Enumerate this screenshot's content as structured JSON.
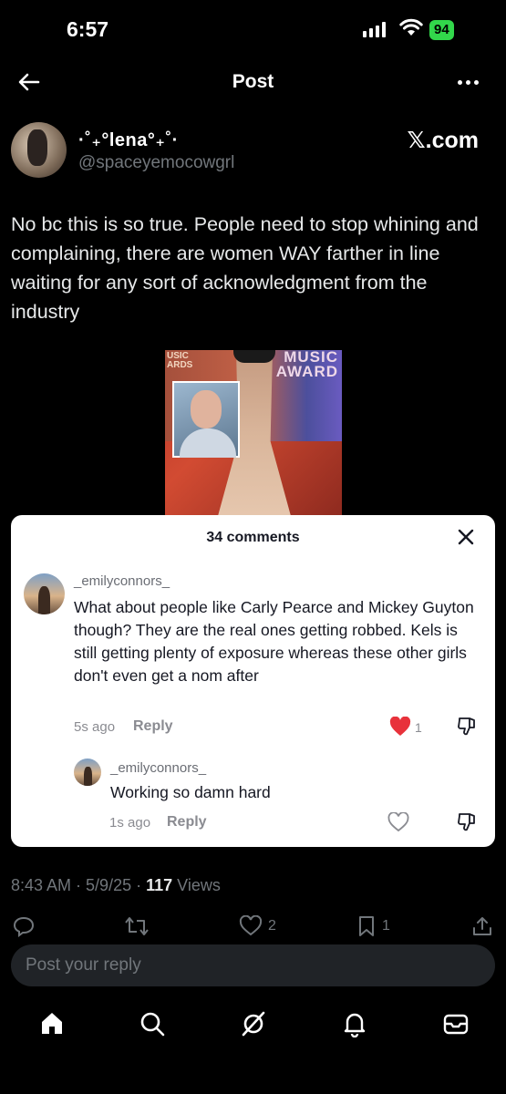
{
  "status_bar": {
    "time": "6:57",
    "battery": "94"
  },
  "header": {
    "title": "Post"
  },
  "post": {
    "display_name": "·˚₊°lena°₊˚·",
    "handle": "@spaceyemocowgrl",
    "source": "𝕏.com",
    "text": "No bc this is so true. People need to stop whining and complaining, there are women WAY farther in line waiting for any sort of acknowledgment from the industry",
    "media": {
      "text_left": "USIC\nARDS",
      "text_right": "MUSIC\nAWARD"
    }
  },
  "comments": {
    "count_label": "34 comments",
    "items": [
      {
        "username": "_emilyconnors_",
        "text": "What about people like Carly Pearce and Mickey Guyton though? They are the real ones getting robbed. Kels is still getting plenty of exposure whereas these other girls don't even get a nom after",
        "time": "5s ago",
        "reply_label": "Reply",
        "likes": "1"
      },
      {
        "username": "_emilyconnors_",
        "text": "Working so damn hard",
        "time": "1s ago",
        "reply_label": "Reply"
      }
    ]
  },
  "post_meta": {
    "time": "8:43 AM",
    "date": "5/9/25",
    "views_count": "117",
    "views_label": "Views"
  },
  "actions": {
    "likes": "2",
    "bookmarks": "1"
  },
  "reply_input": {
    "placeholder": "Post your reply"
  },
  "colors": {
    "like_red": "#e8323b",
    "battery_green": "#32d74b",
    "background": "#000000"
  }
}
